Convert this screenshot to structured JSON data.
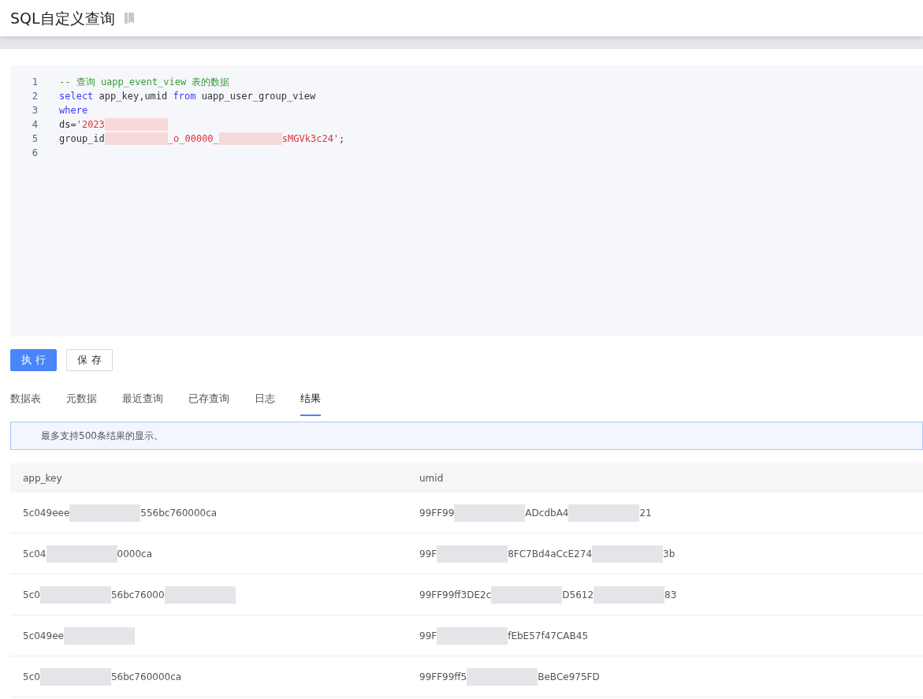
{
  "page": {
    "title": "SQL自定义查询"
  },
  "editor": {
    "lines": [
      {
        "number": "1",
        "tokens": [
          {
            "kind": "comment",
            "text": "-- 查询 uapp_event_view 表的数据"
          }
        ]
      },
      {
        "number": "2",
        "tokens": [
          {
            "kind": "keyword",
            "text": "select"
          },
          {
            "kind": "plain",
            "text": " app_key,umid "
          },
          {
            "kind": "keyword",
            "text": "from"
          },
          {
            "kind": "plain",
            "text": " uapp_user_group_view"
          }
        ]
      },
      {
        "number": "3",
        "tokens": [
          {
            "kind": "keyword",
            "text": "where"
          }
        ]
      },
      {
        "number": "4",
        "tokens": [
          {
            "kind": "plain",
            "text": "ds="
          },
          {
            "kind": "string",
            "text": "'2023"
          },
          {
            "kind": "redacted"
          }
        ]
      },
      {
        "number": "5",
        "tokens": [
          {
            "kind": "plain",
            "text": "group_id"
          },
          {
            "kind": "redacted"
          },
          {
            "kind": "string",
            "text": "_o_00000_"
          },
          {
            "kind": "redacted"
          },
          {
            "kind": "string",
            "text": "sMGVk3c24'"
          },
          {
            "kind": "plain",
            "text": ";"
          }
        ]
      },
      {
        "number": "6"
      }
    ]
  },
  "buttons": [
    {
      "label": "执 行",
      "kind": "primary"
    },
    {
      "label": "保 存",
      "kind": "default"
    }
  ],
  "tabs": [
    {
      "label": "数据表",
      "selected": false
    },
    {
      "label": "元数据",
      "selected": false
    },
    {
      "label": "最近查询",
      "selected": false
    },
    {
      "label": "已存查询",
      "selected": false
    },
    {
      "label": "日志",
      "selected": false
    },
    {
      "label": "结果",
      "selected": true
    }
  ],
  "notice": "最多支持500条结果的显示。",
  "table": {
    "columns": [
      "app_key",
      "umid"
    ],
    "rows": [
      [
        [
          {
            "kind": "text",
            "text": "5c049eee"
          },
          {
            "kind": "redacted"
          },
          {
            "kind": "text",
            "text": "556bc760000ca"
          }
        ],
        [
          {
            "kind": "text",
            "text": "99FF99"
          },
          {
            "kind": "redacted"
          },
          {
            "kind": "text",
            "text": "ADcdbA4"
          },
          {
            "kind": "redacted"
          },
          {
            "kind": "text",
            "text": "21"
          }
        ]
      ],
      [
        [
          {
            "kind": "text",
            "text": "5c04"
          },
          {
            "kind": "redacted"
          },
          {
            "kind": "text",
            "text": "0000ca"
          }
        ],
        [
          {
            "kind": "text",
            "text": "99F"
          },
          {
            "kind": "redacted"
          },
          {
            "kind": "text",
            "text": "8FC7Bd4aCcE274"
          },
          {
            "kind": "redacted"
          },
          {
            "kind": "text",
            "text": "3b"
          }
        ]
      ],
      [
        [
          {
            "kind": "text",
            "text": "5c0"
          },
          {
            "kind": "redacted"
          },
          {
            "kind": "text",
            "text": "56bc76000"
          },
          {
            "kind": "redacted"
          }
        ],
        [
          {
            "kind": "text",
            "text": "99FF99ff3DE2c"
          },
          {
            "kind": "redacted"
          },
          {
            "kind": "text",
            "text": "D5612"
          },
          {
            "kind": "redacted"
          },
          {
            "kind": "text",
            "text": "83"
          }
        ]
      ],
      [
        [
          {
            "kind": "text",
            "text": "5c049ee"
          },
          {
            "kind": "redacted"
          }
        ],
        [
          {
            "kind": "text",
            "text": "99F"
          },
          {
            "kind": "redacted"
          },
          {
            "kind": "text",
            "text": "fEbE57f47CAB45"
          }
        ]
      ],
      [
        [
          {
            "kind": "text",
            "text": "5c0"
          },
          {
            "kind": "redacted"
          },
          {
            "kind": "text",
            "text": "56bc760000ca"
          }
        ],
        [
          {
            "kind": "text",
            "text": "99FF99ff5"
          },
          {
            "kind": "redacted"
          },
          {
            "kind": "text",
            "text": "BeBCe975FD"
          }
        ]
      ]
    ]
  }
}
